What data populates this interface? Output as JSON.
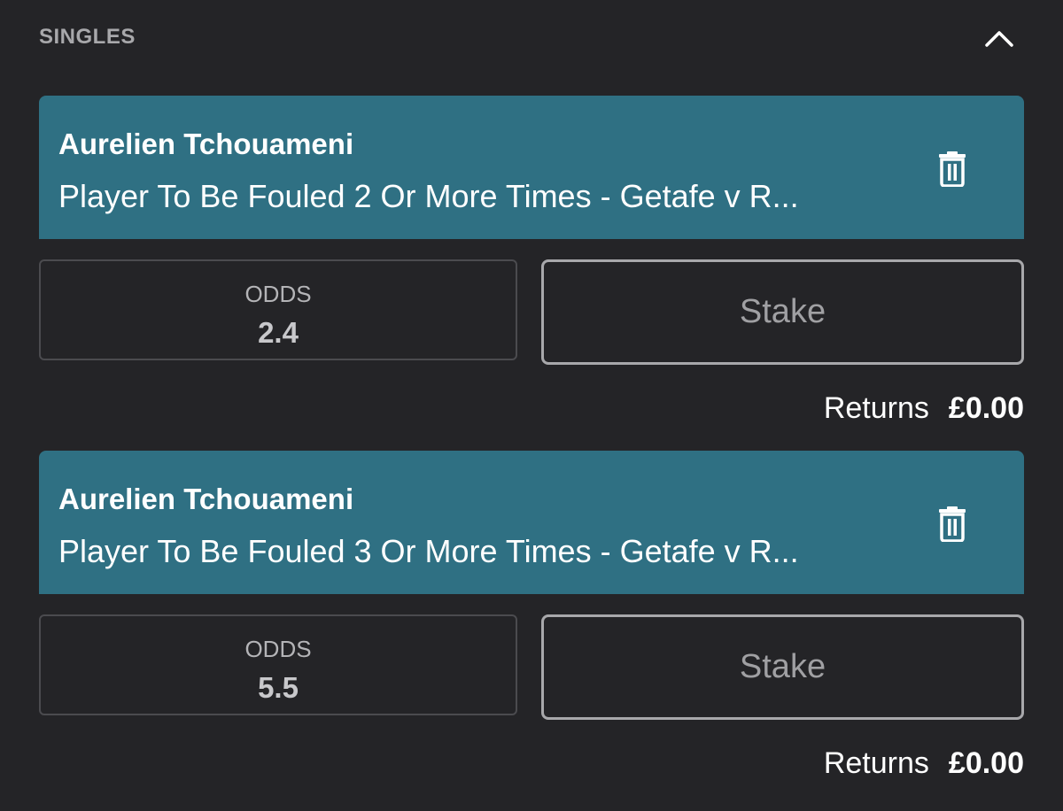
{
  "section": {
    "title": "SINGLES",
    "collapse_icon": "chevron-up-icon"
  },
  "bets": [
    {
      "player": "Aurelien Tchouameni",
      "market": "Player To Be Fouled 2 Or More Times - Getafe v R...",
      "odds_label": "ODDS",
      "odds": "2.4",
      "stake_placeholder": "Stake",
      "returns_label": "Returns",
      "returns_value": "£0.00",
      "delete_icon": "trash-icon"
    },
    {
      "player": "Aurelien Tchouameni",
      "market": "Player To Be Fouled 3 Or More Times - Getafe v R...",
      "odds_label": "ODDS",
      "odds": "5.5",
      "stake_placeholder": "Stake",
      "returns_label": "Returns",
      "returns_value": "£0.00",
      "delete_icon": "trash-icon"
    }
  ],
  "colors": {
    "background": "#242427",
    "bet_header": "#2f7083",
    "section_title": "#a8a8ab",
    "odds_border": "#4b4b4f",
    "stake_border": "#a8a8ab"
  }
}
